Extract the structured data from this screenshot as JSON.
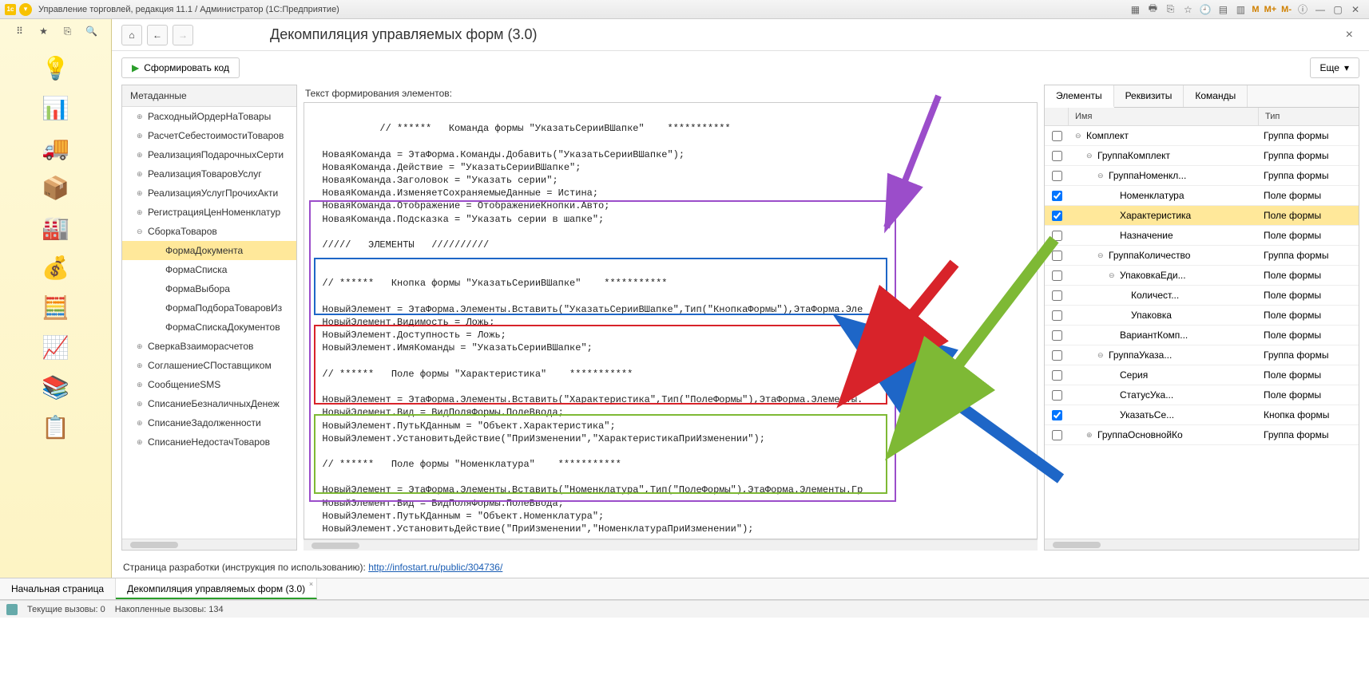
{
  "titlebar": {
    "app": "Управление торговлей, редакция 11.1 / Администратор  (1С:Предприятие)",
    "marks": [
      "M",
      "M+",
      "M-"
    ]
  },
  "page_title": "Декомпиляция управляемых форм (3.0)",
  "generate_btn": "Сформировать код",
  "more_btn": "Еще",
  "meta_header": "Метаданные",
  "meta_items": [
    {
      "label": "РасходныйОрдерНаТовары",
      "lvl": 1,
      "exp": "⊕"
    },
    {
      "label": "РасчетСебестоимостиТоваров",
      "lvl": 1,
      "exp": "⊕"
    },
    {
      "label": "РеализацияПодарочныхСерти",
      "lvl": 1,
      "exp": "⊕"
    },
    {
      "label": "РеализацияТоваровУслуг",
      "lvl": 1,
      "exp": "⊕"
    },
    {
      "label": "РеализацияУслугПрочихАкти",
      "lvl": 1,
      "exp": "⊕"
    },
    {
      "label": "РегистрацияЦенНоменклатур",
      "lvl": 1,
      "exp": "⊕"
    },
    {
      "label": "СборкаТоваров",
      "lvl": 1,
      "exp": "⊖"
    },
    {
      "label": "ФормаДокумента",
      "lvl": 2,
      "exp": "",
      "sel": true
    },
    {
      "label": "ФормаСписка",
      "lvl": 2,
      "exp": ""
    },
    {
      "label": "ФормаВыбора",
      "lvl": 2,
      "exp": ""
    },
    {
      "label": "ФормаПодбораТоваровИз",
      "lvl": 2,
      "exp": ""
    },
    {
      "label": "ФормаСпискаДокументов",
      "lvl": 2,
      "exp": ""
    },
    {
      "label": "СверкаВзаиморасчетов",
      "lvl": 1,
      "exp": "⊕"
    },
    {
      "label": "СоглашениеСПоставщиком",
      "lvl": 1,
      "exp": "⊕"
    },
    {
      "label": "СообщениеSMS",
      "lvl": 1,
      "exp": "⊕"
    },
    {
      "label": "СписаниеБезналичныхДенеж",
      "lvl": 1,
      "exp": "⊕"
    },
    {
      "label": "СписаниеЗадолженности",
      "lvl": 1,
      "exp": "⊕"
    },
    {
      "label": "СписаниеНедостачТоваров",
      "lvl": 1,
      "exp": "⊕"
    }
  ],
  "code_label": "Текст формирования элементов:",
  "code_text": "  // ******   Команда формы \"УказатьСерииВШапке\"    ***********\n\n  НоваяКоманда = ЭтаФорма.Команды.Добавить(\"УказатьСерииВШапке\");\n  НоваяКоманда.Действие = \"УказатьСерииВШапке\";\n  НоваяКоманда.Заголовок = \"Указать серии\";\n  НоваяКоманда.ИзменяетСохраняемыеДанные = Истина;\n  НоваяКоманда.Отображение = ОтображениеКнопки.Авто;\n  НоваяКоманда.Подсказка = \"Указать серии в шапке\";\n\n  /////   ЭЛЕМЕНТЫ   //////////\n\n\n  // ******   Кнопка формы \"УказатьСерииВШапке\"    ***********\n\n  НовыйЭлемент = ЭтаФорма.Элементы.Вставить(\"УказатьСерииВШапке\",Тип(\"КнопкаФормы\"),ЭтаФорма.Эле\n  НовыйЭлемент.Видимость = Ложь;\n  НовыйЭлемент.Доступность = Ложь;\n  НовыйЭлемент.ИмяКоманды = \"УказатьСерииВШапке\";\n\n  // ******   Поле формы \"Характеристика\"    ***********\n\n  НовыйЭлемент = ЭтаФорма.Элементы.Вставить(\"Характеристика\",Тип(\"ПолеФормы\"),ЭтаФорма.Элементы.\n  НовыйЭлемент.Вид = ВидПоляФормы.ПолеВвода;\n  НовыйЭлемент.ПутьКДанным = \"Объект.Характеристика\";\n  НовыйЭлемент.УстановитьДействие(\"ПриИзменении\",\"ХарактеристикаПриИзменении\");\n\n  // ******   Поле формы \"Номенклатура\"    ***********\n\n  НовыйЭлемент = ЭтаФорма.Элементы.Вставить(\"Номенклатура\",Тип(\"ПолеФормы\"),ЭтаФорма.Элементы.Гр\n  НовыйЭлемент.Вид = ВидПоляФормы.ПолеВвода;\n  НовыйЭлемент.ПутьКДанным = \"Объект.Номенклатура\";\n  НовыйЭлемент.УстановитьДействие(\"ПриИзменении\",\"НоменклатураПриИзменении\");",
  "right_tabs": [
    "Элементы",
    "Реквизиты",
    "Команды"
  ],
  "grid_head": {
    "name": "Имя",
    "type": "Тип"
  },
  "grid_rows": [
    {
      "chk": false,
      "name": "Комплект",
      "type": "Группа формы",
      "ind": 0,
      "exp": "⊖"
    },
    {
      "chk": false,
      "name": "ГруппаКомплект",
      "type": "Группа формы",
      "ind": 1,
      "exp": "⊖"
    },
    {
      "chk": false,
      "name": "ГруппаНоменкл...",
      "type": "Группа формы",
      "ind": 2,
      "exp": "⊖"
    },
    {
      "chk": true,
      "name": "Номенклатура",
      "type": "Поле формы",
      "ind": 3,
      "exp": ""
    },
    {
      "chk": true,
      "name": "Характеристика",
      "type": "Поле формы",
      "ind": 3,
      "exp": "",
      "sel": true
    },
    {
      "chk": false,
      "name": "Назначение",
      "type": "Поле формы",
      "ind": 3,
      "exp": ""
    },
    {
      "chk": false,
      "name": "ГруппаКоличество",
      "type": "Группа формы",
      "ind": 2,
      "exp": "⊖"
    },
    {
      "chk": false,
      "name": "УпаковкаЕди...",
      "type": "Поле формы",
      "ind": 3,
      "exp": "⊖"
    },
    {
      "chk": false,
      "name": "Количест...",
      "type": "Поле формы",
      "ind": 4,
      "exp": ""
    },
    {
      "chk": false,
      "name": "Упаковка",
      "type": "Поле формы",
      "ind": 4,
      "exp": ""
    },
    {
      "chk": false,
      "name": "ВариантКомп...",
      "type": "Поле формы",
      "ind": 3,
      "exp": ""
    },
    {
      "chk": false,
      "name": "ГруппаУказа...",
      "type": "Группа формы",
      "ind": 2,
      "exp": "⊖"
    },
    {
      "chk": false,
      "name": "Серия",
      "type": "Поле формы",
      "ind": 3,
      "exp": ""
    },
    {
      "chk": false,
      "name": "СтатусУка...",
      "type": "Поле формы",
      "ind": 3,
      "exp": ""
    },
    {
      "chk": true,
      "name": "УказатьСе...",
      "type": "Кнопка формы",
      "ind": 3,
      "exp": ""
    },
    {
      "chk": false,
      "name": "ГруппаОсновнойКо",
      "type": "Группа формы",
      "ind": 1,
      "exp": "⊕"
    }
  ],
  "footer": {
    "text": "Страница разработки (инструкция по использованию):  ",
    "link": "http://infostart.ru/public/304736/"
  },
  "bottom_tabs": [
    "Начальная страница",
    "Декомпиляция управляемых форм (3.0)"
  ],
  "status": {
    "calls": "Текущие вызовы: 0",
    "queued": "Накопленные вызовы: 134"
  }
}
